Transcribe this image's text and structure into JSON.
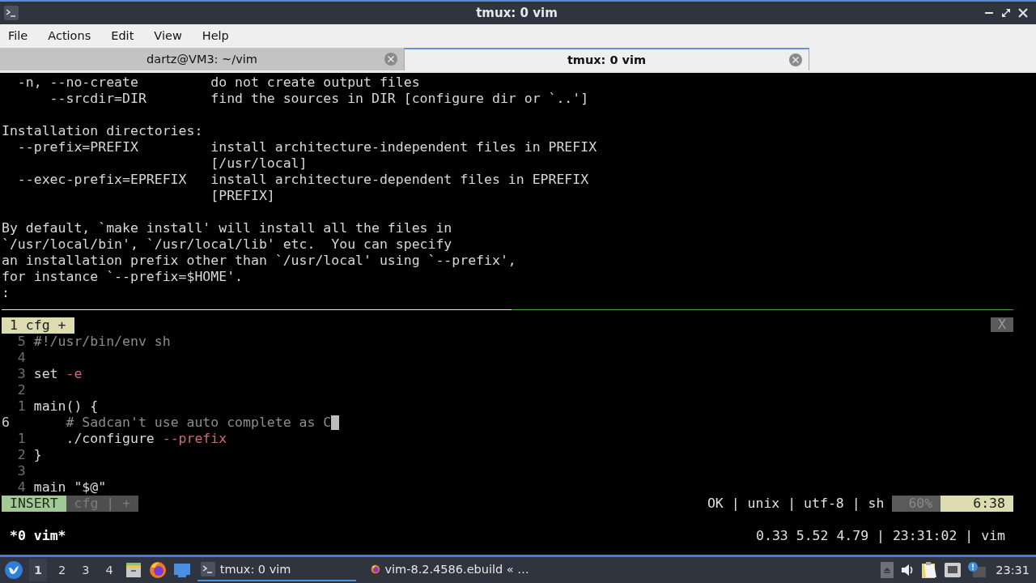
{
  "window": {
    "title": "tmux: 0 vim"
  },
  "menu": [
    "File",
    "Actions",
    "Edit",
    "View",
    "Help"
  ],
  "tabs": [
    {
      "label": "dartz@VM3: ~/vim",
      "selected": false
    },
    {
      "label": "tmux: 0 vim",
      "selected": true
    }
  ],
  "pager": {
    "blocks": [
      [
        {
          "text": "  -n, --no-create         do not create output files"
        },
        {
          "text": "      --srcdir=DIR        find the sources in DIR [configure dir or `..']"
        }
      ],
      [
        {
          "text": "Installation directories:"
        },
        {
          "text": "  --prefix=PREFIX         install architecture-independent files in PREFIX"
        },
        {
          "text": "                          [/usr/local]"
        },
        {
          "text": "  --exec-prefix=EPREFIX   install architecture-dependent files in EPREFIX"
        },
        {
          "text": "                          [PREFIX]"
        }
      ],
      [
        {
          "text": "By default, `make install' will install all the files in"
        },
        {
          "text": "`/usr/local/bin', `/usr/local/lib' etc.  You can specify"
        },
        {
          "text": "an installation prefix other than `/usr/local' using `--prefix',"
        },
        {
          "text": "for instance `--prefix=$HOME'."
        },
        {
          "text": ":"
        }
      ]
    ]
  },
  "vim": {
    "tabline": {
      "label": "1 cfg +",
      "close": "X"
    },
    "lines": [
      {
        "number": "5",
        "current": false,
        "cursor": false,
        "segments": [
          {
            "text": "#!/usr/bin/env sh",
            "kind": "comment"
          }
        ]
      },
      {
        "number": "4",
        "current": false,
        "cursor": false
      },
      {
        "number": "3",
        "current": false,
        "cursor": false,
        "segments": [
          {
            "text": "set ",
            "kind": "text"
          },
          {
            "text": "-e",
            "kind": "flag"
          }
        ]
      },
      {
        "number": "2",
        "current": false,
        "cursor": false
      },
      {
        "number": "1",
        "current": false,
        "cursor": false,
        "segments": [
          {
            "text": "main() {",
            "kind": "text"
          }
        ]
      },
      {
        "number": "6",
        "current": true,
        "cursor": true,
        "segments": [
          {
            "text": "    # Sadcan't use auto complete as C",
            "kind": "comment"
          }
        ]
      },
      {
        "number": "1",
        "current": false,
        "cursor": false,
        "segments": [
          {
            "text": "    ./configure ",
            "kind": "text"
          },
          {
            "text": "--prefix",
            "kind": "flag"
          }
        ]
      },
      {
        "number": "2",
        "current": false,
        "cursor": false,
        "segments": [
          {
            "text": "}",
            "kind": "text"
          }
        ]
      },
      {
        "number": "3",
        "current": false,
        "cursor": false
      },
      {
        "number": "4",
        "current": false,
        "cursor": false,
        "segments": [
          {
            "text": "main \"$@\"",
            "kind": "text"
          }
        ]
      }
    ],
    "statusline": {
      "mode": "INSERT",
      "file": "cfg | +",
      "info": "OK | unix | utf-8 | sh",
      "percent": "60%",
      "position": "6:38"
    }
  },
  "tmux": {
    "left": "*0 vim*",
    "right": "0.33 5.52 4.79 | 23:31:02 | vim"
  },
  "taskbar": {
    "workspaces": [
      {
        "label": "1",
        "selected": true
      },
      {
        "label": "2",
        "selected": false
      },
      {
        "label": "3",
        "selected": false
      },
      {
        "label": "4",
        "selected": false
      }
    ],
    "tasks": [
      {
        "label": "tmux: 0 vim",
        "kind": "terminal",
        "selected": true
      },
      {
        "label": "vim-8.2.4586.ebuild « …",
        "kind": "browser",
        "selected": false
      }
    ],
    "clock": "23:31"
  }
}
